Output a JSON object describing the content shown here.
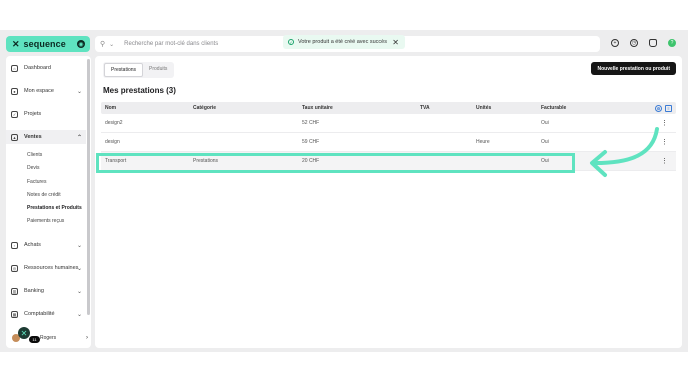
{
  "brand": {
    "name": "sequence",
    "mark": "✕",
    "badge": "◉",
    "color": "#5fe3c0"
  },
  "search": {
    "placeholder": "Recherche par mot-clé dans clients"
  },
  "toast": {
    "message": "Votre produit a été créé avec succès"
  },
  "header_icons": [
    "plus-circle-icon",
    "clock-icon",
    "bell-icon",
    "help-icon"
  ],
  "sidebar": {
    "items": [
      {
        "label": "Dashboard",
        "icon": "home-icon"
      },
      {
        "label": "Mon espace",
        "icon": "user-icon"
      },
      {
        "label": "Projets",
        "icon": "check-square-icon"
      },
      {
        "label": "Ventes",
        "icon": "bag-icon"
      },
      {
        "label": "Achats",
        "icon": "cart-icon"
      },
      {
        "label": "Ressources humaines",
        "icon": "people-icon"
      },
      {
        "label": "Banking",
        "icon": "bank-icon"
      },
      {
        "label": "Comptabilité",
        "icon": "calculator-icon"
      }
    ],
    "sub_items": [
      "Clients",
      "Devis",
      "Factures",
      "Notes de crédit",
      "Prestations et Produits",
      "Paiements reçus"
    ],
    "user": {
      "name": "Rogers",
      "badge": "11"
    }
  },
  "main": {
    "tabs": [
      "Prestations",
      "Produits"
    ],
    "new_button": "Nouvelle prestation ou produit",
    "title": "Mes prestations (3)",
    "columns": [
      "Nom",
      "Catégorie",
      "Taux unitaire",
      "TVA",
      "Unités",
      "Facturable"
    ],
    "rows": [
      {
        "nom": "design2",
        "categorie": "",
        "taux": "52 CHF",
        "tva": "",
        "unites": "",
        "facturable": "Oui"
      },
      {
        "nom": "design",
        "categorie": "",
        "taux": "59 CHF",
        "tva": "",
        "unites": "Heure",
        "facturable": "Oui"
      },
      {
        "nom": "Transport",
        "categorie": "Prestations",
        "taux": "20 CHF",
        "tva": "",
        "unites": "",
        "facturable": "Oui"
      }
    ]
  }
}
